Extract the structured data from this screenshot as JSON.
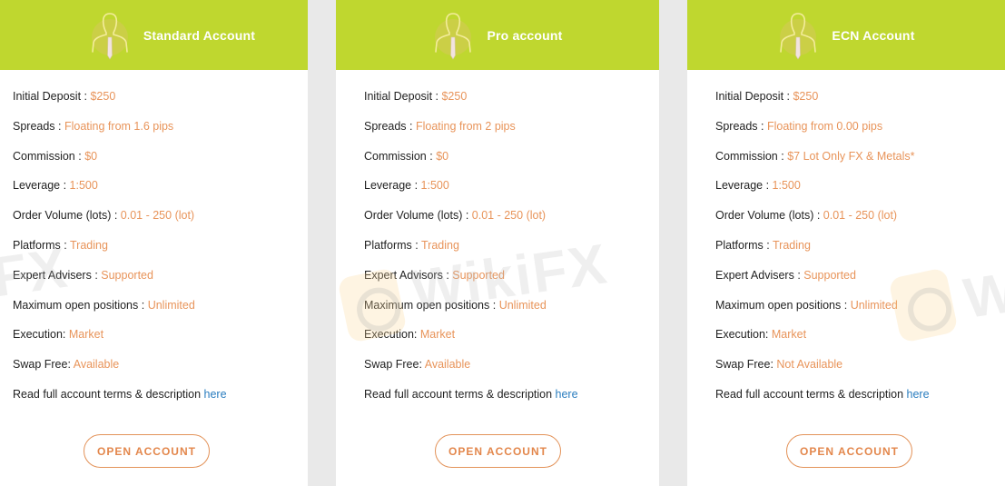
{
  "accounts": [
    {
      "title": "Standard Account",
      "icon": "user-tie-icon",
      "specs": [
        {
          "label": "Initial Deposit : ",
          "value": "$250"
        },
        {
          "label": "Spreads : ",
          "value": "Floating from 1.6 pips"
        },
        {
          "label": "Commission : ",
          "value": "$0"
        },
        {
          "label": "Leverage : ",
          "value": "1:500"
        },
        {
          "label": "Order Volume (lots) : ",
          "value": "0.01 - 250 (lot)"
        },
        {
          "label": "Platforms : ",
          "value": "Trading"
        },
        {
          "label": "Expert Advisers : ",
          "value": "Supported"
        },
        {
          "label": "Maximum open positions : ",
          "value": "Unlimited"
        },
        {
          "label": "Execution: ",
          "value": "Market"
        },
        {
          "label": "Swap Free: ",
          "value": "Available"
        }
      ],
      "terms_text": "Read full account terms & description ",
      "terms_link": "here",
      "button_label": "OPEN ACCOUNT"
    },
    {
      "title": "Pro account",
      "icon": "user-tie-icon",
      "specs": [
        {
          "label": "Initial Deposit : ",
          "value": "$250"
        },
        {
          "label": "Spreads : ",
          "value": "Floating from 2 pips"
        },
        {
          "label": "Commission : ",
          "value": "$0"
        },
        {
          "label": "Leverage : ",
          "value": "1:500"
        },
        {
          "label": "Order Volume (lots) : ",
          "value": "0.01 - 250 (lot)"
        },
        {
          "label": "Platforms : ",
          "value": "Trading"
        },
        {
          "label": "Expert Advisors : ",
          "value": "Supported"
        },
        {
          "label": "Maximum open positions : ",
          "value": "Unlimited"
        },
        {
          "label": "Execution: ",
          "value": "Market"
        },
        {
          "label": "Swap Free: ",
          "value": "Available"
        }
      ],
      "terms_text": "Read full account terms & description ",
      "terms_link": "here",
      "button_label": "OPEN ACCOUNT"
    },
    {
      "title": "ECN Account",
      "icon": "user-tie-icon",
      "specs": [
        {
          "label": "Initial Deposit : ",
          "value": "$250"
        },
        {
          "label": "Spreads : ",
          "value": "Floating from 0.00 pips"
        },
        {
          "label": "Commission : ",
          "value": "$7 Lot Only FX & Metals*"
        },
        {
          "label": "Leverage : ",
          "value": "1:500"
        },
        {
          "label": "Order Volume (lots) : ",
          "value": "0.01 - 250 (lot)"
        },
        {
          "label": "Platforms : ",
          "value": "Trading"
        },
        {
          "label": "Expert Advisers : ",
          "value": "Supported"
        },
        {
          "label": "Maximum open positions : ",
          "value": "Unlimited"
        },
        {
          "label": "Execution: ",
          "value": "Market"
        },
        {
          "label": "Swap Free: ",
          "value": "Not Available"
        }
      ],
      "terms_text": "Read full account terms & description ",
      "terms_link": "here",
      "button_label": "OPEN ACCOUNT"
    }
  ],
  "watermark": {
    "text_1": "FX",
    "text_2": "WikiFX",
    "text_3": "W"
  },
  "colors": {
    "header_green": "#bfd72f",
    "value_orange": "#e8945a",
    "link_blue": "#2a7dbf",
    "button_orange": "#e3874c",
    "gap_gray": "#e9e9e9"
  }
}
